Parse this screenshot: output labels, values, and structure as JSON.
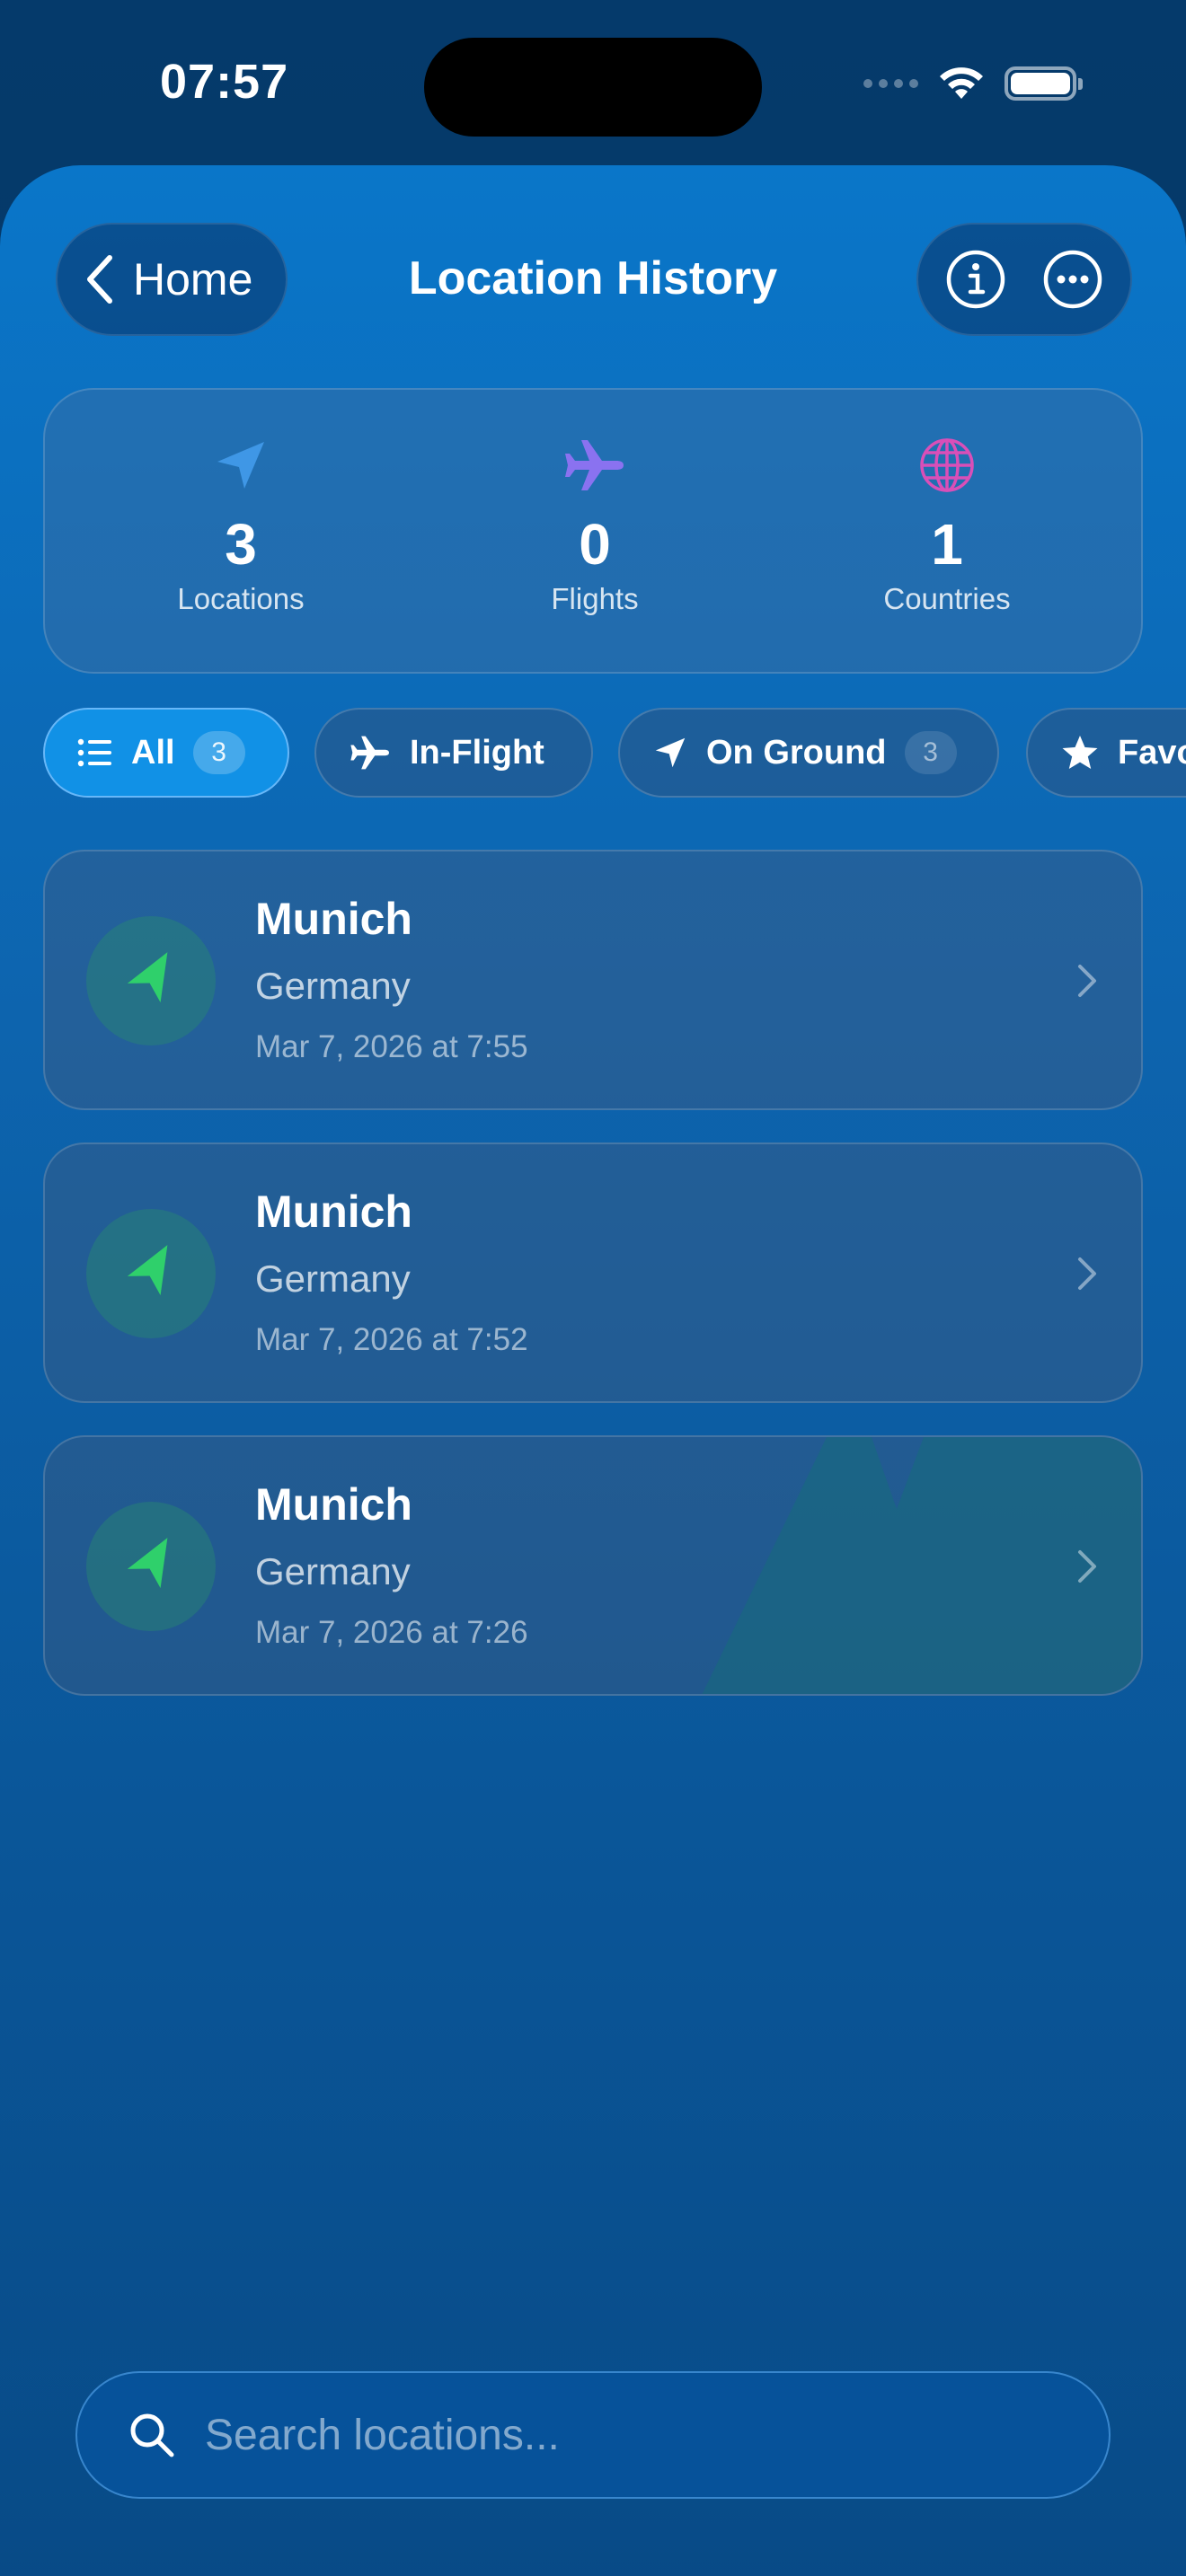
{
  "status_bar": {
    "time": "07:57"
  },
  "nav": {
    "back_label": "Home",
    "title": "Location History",
    "info_icon": "info-circle-icon",
    "more_icon": "ellipsis-circle-icon"
  },
  "stats": [
    {
      "icon": "location-arrow-icon",
      "value": "3",
      "label": "Locations",
      "color": "#3f97e6"
    },
    {
      "icon": "airplane-icon",
      "value": "0",
      "label": "Flights",
      "color": "#8a72f0"
    },
    {
      "icon": "globe-icon",
      "value": "1",
      "label": "Countries",
      "color": "#d94fb8"
    }
  ],
  "filters": [
    {
      "icon": "list-icon",
      "label": "All",
      "count": "3",
      "active": true
    },
    {
      "icon": "airplane-icon",
      "label": "In-Flight",
      "count": "",
      "active": false
    },
    {
      "icon": "location-arrow-icon",
      "label": "On Ground",
      "count": "3",
      "active": false
    },
    {
      "icon": "star-icon",
      "label": "Favo",
      "count": "",
      "active": false
    }
  ],
  "locations": [
    {
      "city": "Munich",
      "country": "Germany",
      "timestamp": "Mar 7, 2026 at 7:55"
    },
    {
      "city": "Munich",
      "country": "Germany",
      "timestamp": "Mar 7, 2026 at 7:52"
    },
    {
      "city": "Munich",
      "country": "Germany",
      "timestamp": "Mar 7, 2026 at 7:26"
    }
  ],
  "search": {
    "placeholder": "Search locations..."
  },
  "colors": {
    "accent": "#1191e6",
    "ground_green": "#2fd06b"
  }
}
